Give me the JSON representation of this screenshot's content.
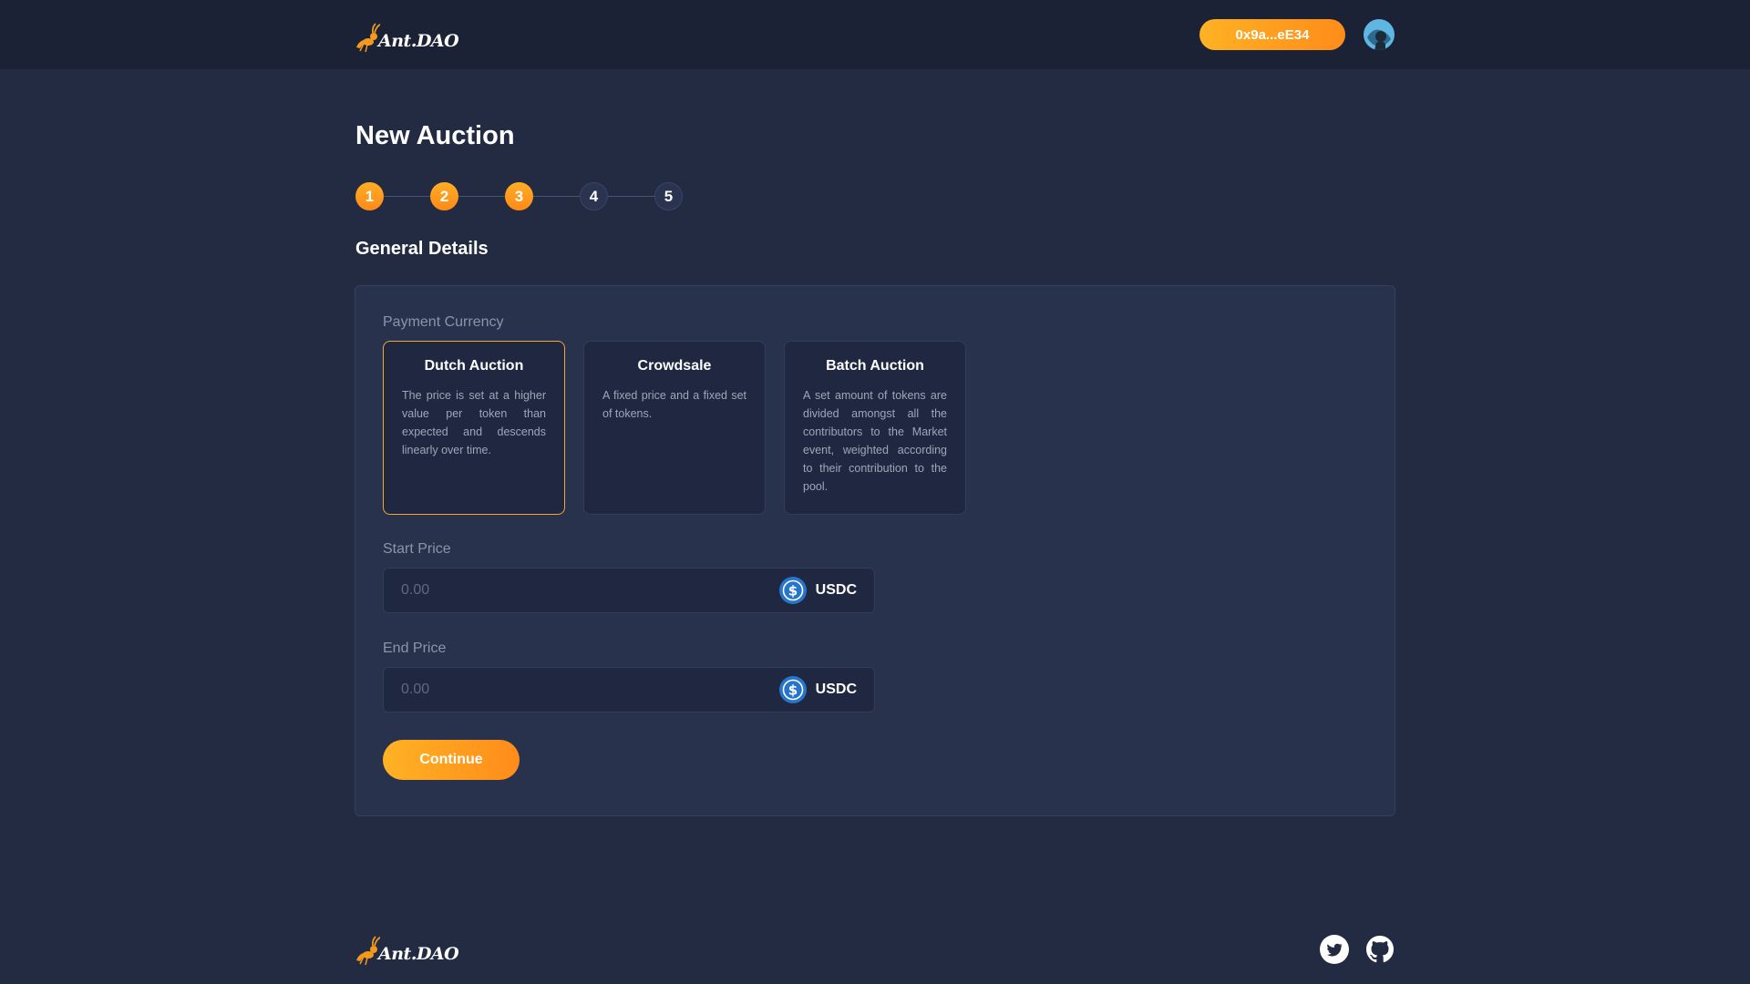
{
  "header": {
    "logo_text": "Ant.DAO",
    "wallet_label": "0x9a...eE34"
  },
  "page": {
    "title": "New Auction",
    "section_title": "General Details"
  },
  "stepper": {
    "steps": [
      "1",
      "2",
      "3",
      "4",
      "5"
    ],
    "completed_count": 3
  },
  "form": {
    "payment_currency_label": "Payment Currency",
    "auction_types": [
      {
        "title": "Dutch Auction",
        "description": "The price is set at a higher value per token than expected and descends linearly over time.",
        "selected": true
      },
      {
        "title": "Crowdsale",
        "description": "A fixed price and a fixed set of tokens.",
        "selected": false
      },
      {
        "title": "Batch Auction",
        "description": "A set amount of tokens are divided amongst all the contributors to the Market event, weighted according to their contribution to the pool.",
        "selected": false
      }
    ],
    "start_price": {
      "label": "Start Price",
      "placeholder": "0.00",
      "value": "",
      "currency": "USDC"
    },
    "end_price": {
      "label": "End Price",
      "placeholder": "0.00",
      "value": "",
      "currency": "USDC"
    },
    "continue_label": "Continue"
  },
  "footer": {
    "logo_text": "Ant.DAO",
    "social_icons": [
      "twitter-icon",
      "github-icon"
    ]
  },
  "colors": {
    "background": "#222b42",
    "header_background": "#1b2236",
    "card_background": "#28324d",
    "accent": "#ff9f20",
    "usdc_blue": "#2775ca"
  }
}
